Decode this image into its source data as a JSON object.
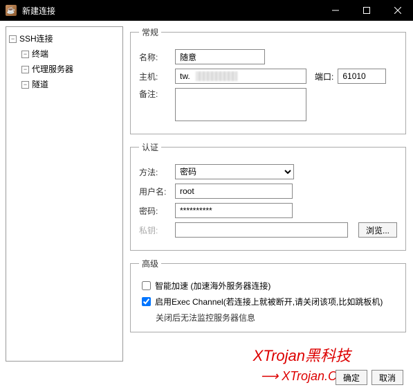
{
  "window": {
    "title": "新建连接"
  },
  "tree": {
    "root": "SSH连接",
    "items": [
      "终端",
      "代理服务器",
      "隧道"
    ]
  },
  "general": {
    "legend": "常规",
    "name_label": "名称:",
    "name_value": "随意",
    "host_label": "主机:",
    "host_value": "tw.",
    "port_label": "端口:",
    "port_value": "61010",
    "remark_label": "备注:"
  },
  "auth": {
    "legend": "认证",
    "method_label": "方法:",
    "method_value": "密码",
    "user_label": "用户名:",
    "user_value": "root",
    "pass_label": "密码:",
    "pass_value": "**********",
    "key_label": "私钥:",
    "browse_label": "浏览..."
  },
  "advanced": {
    "legend": "高级",
    "smart_label": "智能加速 (加速海外服务器连接)",
    "exec_label": "启用Exec Channel(若连接上就被断开,请关闭该项,比如跳板机)",
    "exec_note": "关闭后无法监控服务器信息"
  },
  "buttons": {
    "ok": "确定",
    "cancel": "取消"
  },
  "watermark": {
    "line1": "XTrojan黑科技",
    "line2": "XTrojan.C"
  }
}
